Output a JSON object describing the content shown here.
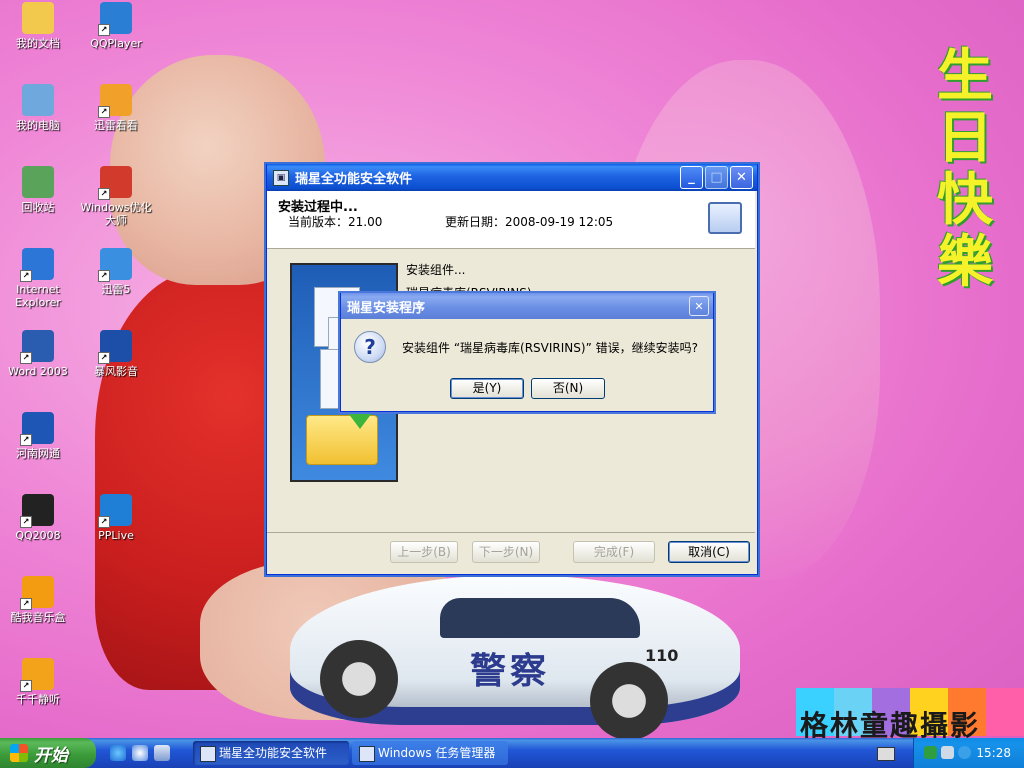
{
  "desktop": {
    "wallpaper": {
      "greeting": "生日快樂",
      "studio_name": "格林童趣攝影",
      "police_car_text": "警察",
      "police_car_number": "110"
    },
    "icons": [
      {
        "label": "我的文档",
        "icon": "my-documents-icon",
        "color": "#f2c94c"
      },
      {
        "label": "QQPlayer",
        "icon": "qqplayer-icon",
        "color": "#2a7fd4"
      },
      {
        "label": "我的电脑",
        "icon": "my-computer-icon",
        "color": "#6fa8dc"
      },
      {
        "label": "迅雷看看",
        "icon": "xunlei-kankan-icon",
        "color": "#f1a12a"
      },
      {
        "label": "回收站",
        "icon": "recycle-bin-icon",
        "color": "#5aa35a"
      },
      {
        "label": "Windows优化大师",
        "icon": "windows-optimizer-icon",
        "color": "#d23b2b"
      },
      {
        "label": "Internet Explorer",
        "icon": "internet-explorer-icon",
        "color": "#2b76d6"
      },
      {
        "label": "迅雷5",
        "icon": "xunlei5-icon",
        "color": "#3a8fe0"
      },
      {
        "label": "Word 2003",
        "icon": "word-icon",
        "color": "#2a5db0"
      },
      {
        "label": "暴风影音",
        "icon": "baofeng-icon",
        "color": "#1d4fa8"
      },
      {
        "label": "河南网通",
        "icon": "henan-netcom-icon",
        "color": "#1e56b5"
      },
      {
        "label": "QQ2008",
        "icon": "qq-icon",
        "color": "#222222"
      },
      {
        "label": "PPLive",
        "icon": "pplive-icon",
        "color": "#1f7fd6"
      },
      {
        "label": "酷我音乐盒",
        "icon": "kuwo-music-icon",
        "color": "#f39c12"
      },
      {
        "label": "千千静听",
        "icon": "ttplayer-icon",
        "color": "#f2a31a"
      }
    ]
  },
  "installer": {
    "title": "瑞星全功能安全软件",
    "header_title": "安装过程中...",
    "version_label": "当前版本：21.00",
    "date_label": "更新日期：2008-09-19 12:05",
    "status_line1": "安装组件...",
    "status_line2": "瑞星病毒库(RSVIRINS)",
    "buttons": {
      "back": "上一步(B)",
      "next": "下一步(N)",
      "finish": "完成(F)",
      "cancel": "取消(C)"
    },
    "title_buttons": {
      "min": "_",
      "max": "□",
      "close": "✕"
    }
  },
  "dialog": {
    "title": "瑞星安装程序",
    "message": "安装组件 “瑞星病毒库(RSVIRINS)” 错误，继续安装吗?",
    "icon_glyph": "?",
    "yes": "是(Y)",
    "no": "否(N)",
    "close": "✕"
  },
  "taskbar": {
    "start_label": "开始",
    "tasks": [
      {
        "label": "瑞星全功能安全软件",
        "active": true
      },
      {
        "label": "Windows 任务管理器",
        "active": false
      }
    ],
    "clock": "15:28"
  },
  "colors": {
    "xp_blue": "#0a5ce8",
    "start_green": "#3c9c3a",
    "tray_blue": "#0f8be8"
  }
}
